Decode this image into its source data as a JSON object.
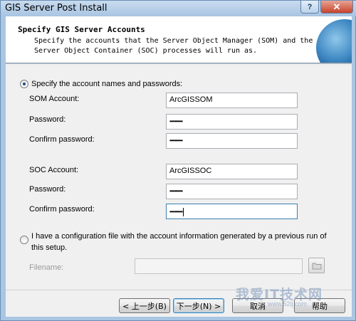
{
  "window": {
    "title": "GIS Server Post Install",
    "help_glyph": "?",
    "close_glyph": "✕"
  },
  "header": {
    "title": "Specify GIS Server Accounts",
    "description": "Specify the accounts that the Server Object Manager (SOM) and the\nServer Object Container (SOC) processes will run as."
  },
  "option_specify": {
    "label": "Specify the account names and passwords:",
    "selected": true
  },
  "som": {
    "account_label": "SOM Account:",
    "account_value": "ArcGISSOM",
    "password_label": "Password:",
    "password_value": "••••••••••",
    "confirm_label": "Confirm password:",
    "confirm_value": "••••••••••"
  },
  "soc": {
    "account_label": "SOC Account:",
    "account_value": "ArcGISSOC",
    "password_label": "Password:",
    "password_value": "••••••••••",
    "confirm_label": "Confirm password:",
    "confirm_value": "••••••••••"
  },
  "option_config": {
    "label": "I have a configuration file with the account information generated by a previous run of this setup.",
    "selected": false
  },
  "filename": {
    "label": "Filename:",
    "value": ""
  },
  "buttons": {
    "back": "< 上一步(B)",
    "next": "下一步(N) >",
    "cancel": "取消",
    "help": "帮助"
  },
  "watermark": {
    "text": "我爱IT技术网",
    "sub": "www.52ij.com"
  },
  "colors": {
    "title_bar": "#a8c4e2",
    "close_button": "#c7432b",
    "focus_border": "#3c7fb1"
  }
}
